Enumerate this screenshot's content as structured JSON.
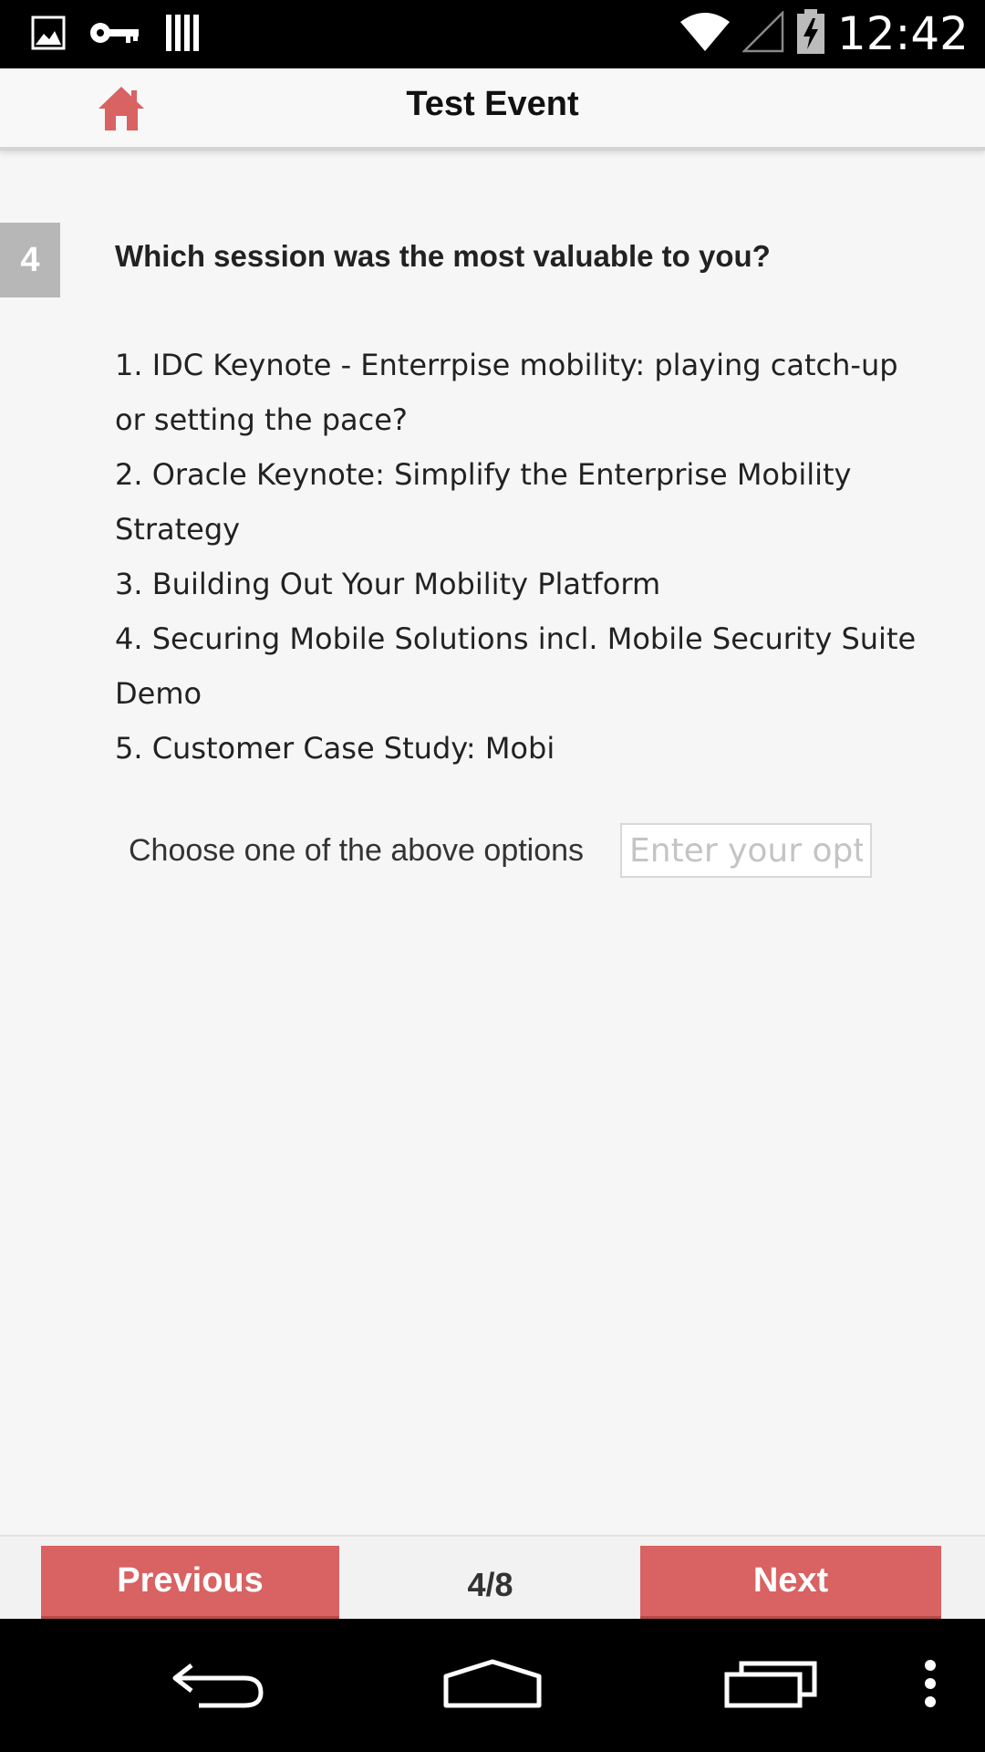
{
  "status_bar": {
    "time": "12:42",
    "icons": [
      "image-icon",
      "key-icon",
      "barcode-icon",
      "wifi-icon",
      "signal-icon",
      "battery-charging-icon"
    ]
  },
  "header": {
    "title": "Test Event",
    "home_icon": "home-icon",
    "accent_color": "#d96262"
  },
  "question": {
    "number": "4",
    "text": "Which session was the most valuable to you?",
    "options": [
      "1. IDC Keynote - Enterrpise mobility: playing catch-up or setting the pace?",
      "2. Oracle Keynote: Simplify the Enterprise Mobility Strategy",
      "3. Building Out Your Mobility Platform",
      "4. Securing Mobile Solutions incl. Mobile Security Suite Demo",
      "5. Customer Case Study: Mobi"
    ],
    "choose_label": "Choose one of the above options",
    "input_placeholder": "Enter your option",
    "input_value": ""
  },
  "navigation": {
    "previous_label": "Previous",
    "next_label": "Next",
    "page_indicator": "4/8",
    "button_color": "#d96262"
  },
  "system_nav": {
    "icons": [
      "back-icon",
      "home-outline-icon",
      "recents-icon",
      "overflow-menu-icon"
    ]
  }
}
